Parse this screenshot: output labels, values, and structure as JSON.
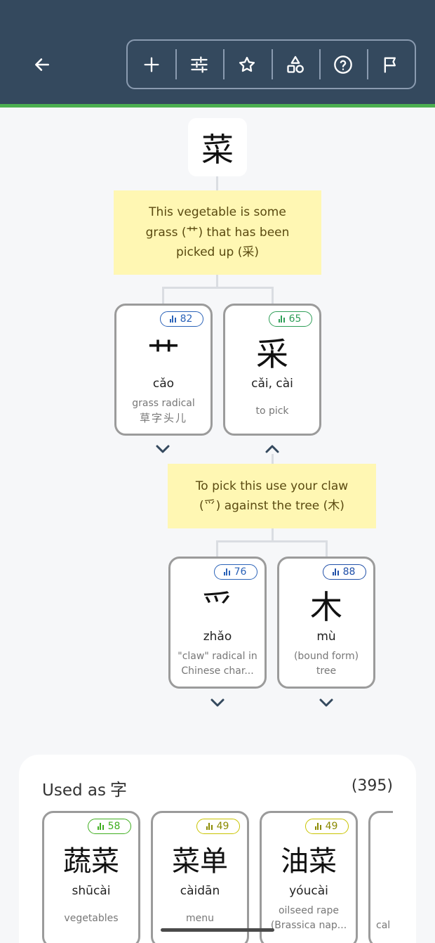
{
  "header": {
    "back_icon": "arrow-left-icon",
    "toolbar": [
      {
        "name": "add",
        "icon": "plus-icon"
      },
      {
        "name": "settings",
        "icon": "sliders-icon"
      },
      {
        "name": "favorite",
        "icon": "star-icon"
      },
      {
        "name": "components",
        "icon": "shapes-icon"
      },
      {
        "name": "help",
        "icon": "help-icon"
      },
      {
        "name": "report",
        "icon": "flag-icon"
      }
    ],
    "colors": {
      "bar": "#34495e",
      "accent": "#4caf50"
    }
  },
  "main_character": "菜",
  "mnemonic_1": {
    "line1": "This vegetable is some",
    "line2": "grass (艹) that has been",
    "line3": "picked up (采)"
  },
  "components": [
    {
      "character": "艹",
      "pinyin": "cǎo",
      "meaning1": "grass radical",
      "meaning2": "草字头儿",
      "score": "82",
      "chevron": "down"
    },
    {
      "character": "采",
      "pinyin": "cǎi, cài",
      "meaning1": "to pick",
      "meaning2": "",
      "score": "65",
      "chevron": "up"
    }
  ],
  "mnemonic_2": {
    "line1": "To pick this use your claw",
    "line2": "(爫) against the tree (木)"
  },
  "subcomponents": [
    {
      "character": "爫",
      "pinyin": "zhǎo",
      "meaning1": "\"claw\" radical in",
      "meaning2": "Chinese char...",
      "score": "76",
      "chevron": "down"
    },
    {
      "character": "木",
      "pinyin": "mù",
      "meaning1": "(bound form)",
      "meaning2": "tree",
      "score": "88",
      "chevron": "down"
    }
  ],
  "used_as": {
    "label": "Used as",
    "zi": "字",
    "count": "(395)",
    "words": [
      {
        "word": "蔬菜",
        "pinyin": "shūcài",
        "meaning1": "vegetables",
        "meaning2": "",
        "score": "58"
      },
      {
        "word": "菜单",
        "pinyin": "càidān",
        "meaning1": "menu",
        "meaning2": "",
        "score": "49"
      },
      {
        "word": "油菜",
        "pinyin": "yóucài",
        "meaning1": "oilseed rape",
        "meaning2": "(Brassica nap...",
        "score": "49"
      },
      {
        "word": "",
        "pinyin": "",
        "meaning1": "cal",
        "meaning2": "",
        "score": ""
      }
    ]
  }
}
